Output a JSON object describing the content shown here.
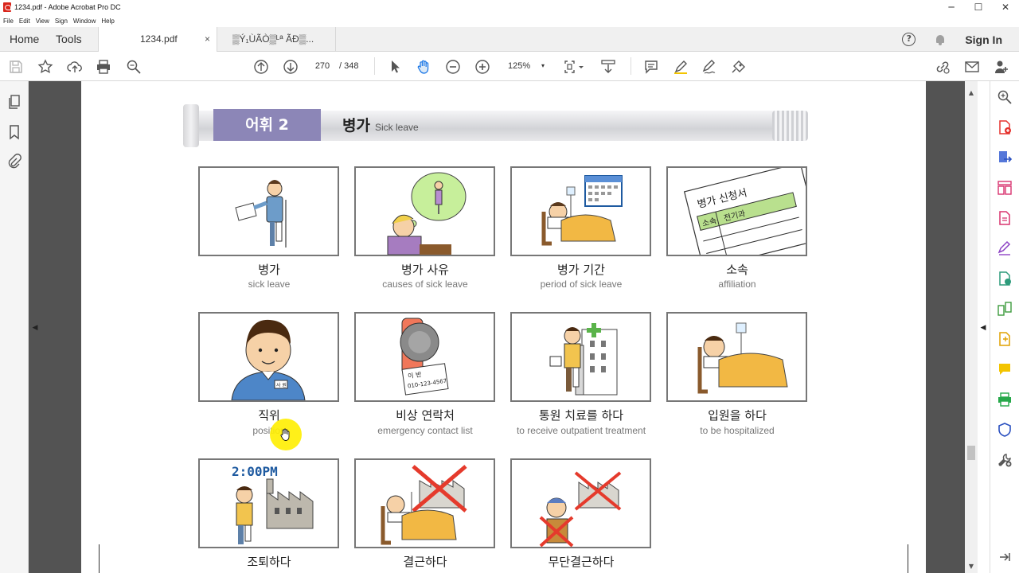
{
  "window": {
    "title": "1234.pdf - Adobe Acrobat Pro DC",
    "controls": [
      "─",
      "☐",
      "✕"
    ]
  },
  "menu": [
    "File",
    "Edit",
    "View",
    "Sign",
    "Window",
    "Help"
  ],
  "tabs": {
    "home": "Home",
    "tools": "Tools",
    "active_doc": "1234.pdf",
    "close": "×",
    "second_doc": "▒Ý₁ÙÃÒ▒ᴸª ÃÐ▒..."
  },
  "header_right": {
    "help": "?",
    "sign_in": "Sign In"
  },
  "toolbar": {
    "page_current": "270",
    "page_total": "/ 348",
    "zoom": "125%",
    "zoom_caret": "▾"
  },
  "arrows": {
    "left": "◀",
    "right": "◀",
    "scroll_up": "▲",
    "scroll_down": "▼"
  },
  "lesson": {
    "label": "어휘 2",
    "title": "병가",
    "subtitle": "Sick leave"
  },
  "vocab": [
    {
      "ko": "병가",
      "en": "sick leave"
    },
    {
      "ko": "병가 사유",
      "en": "causes of sick leave"
    },
    {
      "ko": "병가 기간",
      "en": "period of sick leave"
    },
    {
      "ko": "소속",
      "en": "affiliation"
    },
    {
      "ko": "직위",
      "en": "position"
    },
    {
      "ko": "비상 연락처",
      "en": "emergency contact list"
    },
    {
      "ko": "통원 치료를 하다",
      "en": "to receive outpatient treatment"
    },
    {
      "ko": "입원을 하다",
      "en": "to be hospitalized"
    },
    {
      "ko": "조퇴하다",
      "en": ""
    },
    {
      "ko": "결근하다",
      "en": ""
    },
    {
      "ko": "무단결근하다",
      "en": ""
    }
  ],
  "illustration_text": {
    "form_title": "병가 신청서",
    "form_col1": "소속",
    "form_col2": "전기과",
    "clock": "2:00PM",
    "phone_name": "이 반",
    "phone_number": "010-123-4567",
    "badge": "사 원"
  },
  "colors": {
    "label_purple": "#8c86b7",
    "form_green": "#b9e08e",
    "blanket": "#f2b844",
    "cross_red": "#e53a2c",
    "cursor_yellow": "#ffee00",
    "doc_bg": "#535353"
  }
}
